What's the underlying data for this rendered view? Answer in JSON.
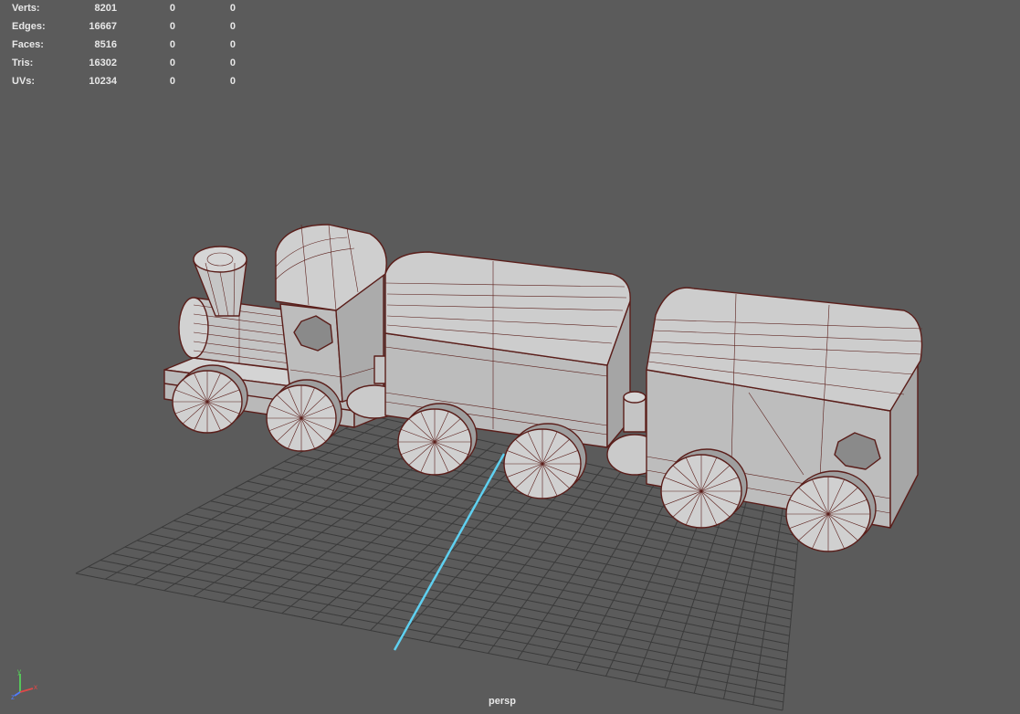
{
  "hud": {
    "rows": [
      {
        "label": "Verts:",
        "v1": "8201",
        "v2": "0",
        "v3": "0"
      },
      {
        "label": "Edges:",
        "v1": "16667",
        "v2": "0",
        "v3": "0"
      },
      {
        "label": "Faces:",
        "v1": "8516",
        "v2": "0",
        "v3": "0"
      },
      {
        "label": "Tris:",
        "v1": "16302",
        "v2": "0",
        "v3": "0"
      },
      {
        "label": "UVs:",
        "v1": "10234",
        "v2": "0",
        "v3": "0"
      }
    ]
  },
  "viewport": {
    "camera": "persp",
    "axis_labels": {
      "x": "x",
      "y": "y",
      "z": "z"
    }
  },
  "colors": {
    "background": "#5b5b5b",
    "grid": "#3a3a3a",
    "wire": "#5a1e1a",
    "mesh": "#c9c9c9",
    "axis_highlight": "#5fd0f0"
  }
}
